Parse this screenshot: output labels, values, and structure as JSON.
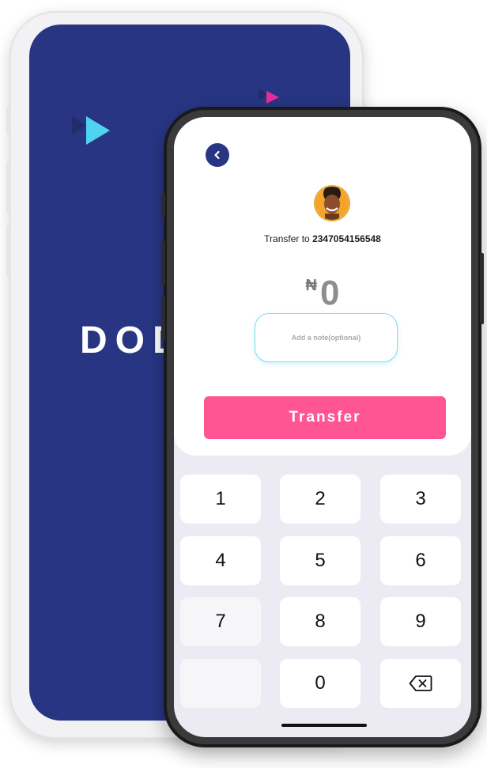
{
  "back_phone": {
    "brand_text": "DOD"
  },
  "header": {
    "back_icon": "chevron-left-icon"
  },
  "recipient": {
    "prefix": "Transfer to ",
    "number": "2347054156548"
  },
  "amount": {
    "currency": "₦",
    "value": "0"
  },
  "note": {
    "placeholder": "Add a note(optional)"
  },
  "transfer_button": {
    "label": "Transfer"
  },
  "keypad": {
    "keys": [
      "1",
      "2",
      "3",
      "4",
      "5",
      "6",
      "7",
      "8",
      "9",
      "",
      "0"
    ],
    "backspace_icon": "backspace-icon"
  },
  "colors": {
    "navy": "#283583",
    "pink": "#ff5592",
    "cyan": "#4fd3f1",
    "magenta": "#e52e97",
    "keypad_bg": "#ecebf3"
  }
}
